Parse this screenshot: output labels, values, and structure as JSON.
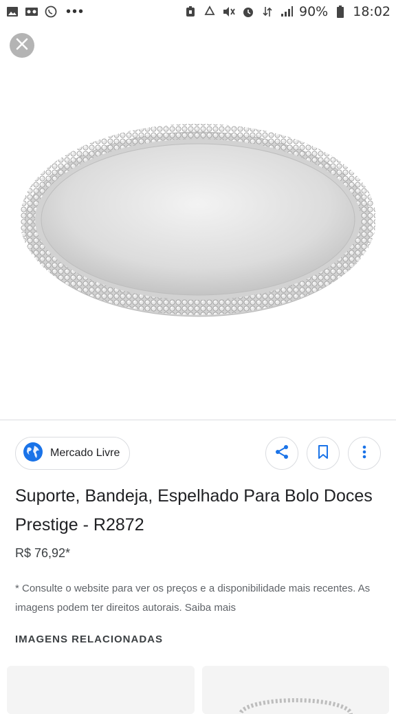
{
  "status_bar": {
    "left_icons": [
      "gallery-icon",
      "voicemail-icon",
      "whatsapp-icon"
    ],
    "overflow": "•••",
    "right_icons": [
      "alarm-icon",
      "recycle-icon",
      "mute-icon",
      "clock-icon",
      "data-icon",
      "signal-icon"
    ],
    "battery": "90%",
    "time": "18:02"
  },
  "viewer": {
    "close_icon": "close-icon"
  },
  "source": {
    "name": "Mercado Livre",
    "icon": "globe-icon"
  },
  "actions": {
    "share_icon": "share-icon",
    "save_icon": "bookmark-icon",
    "more_icon": "more-vert-icon"
  },
  "product": {
    "title": "Suporte, Bandeja, Espelhado Para Bolo Doces Prestige - R2872",
    "price": "R$ 76,92*",
    "disclaimer": "* Consulte o website para ver os preços e a disponibilidade mais recentes. As imagens podem ter direitos autorais. Saiba mais"
  },
  "related": {
    "heading": "IMAGENS RELACIONADAS"
  },
  "colors": {
    "accent_blue": "#1a73e8",
    "close_bg": "#b4b4b4",
    "border": "#dadce0"
  }
}
